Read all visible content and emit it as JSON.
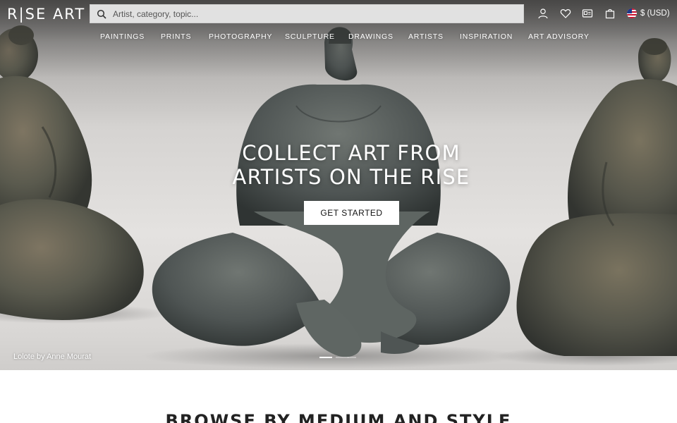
{
  "brand": {
    "logo_text": "R|SE ART"
  },
  "search": {
    "placeholder": "Artist, category, topic..."
  },
  "header_icons": [
    "user-icon",
    "heart-icon",
    "id-card-icon",
    "bag-icon"
  ],
  "currency": {
    "label": "$ (USD)",
    "flag": "us-flag-icon"
  },
  "nav": {
    "items": [
      {
        "label": "PAINTINGS"
      },
      {
        "label": "PRINTS"
      },
      {
        "label": "PHOTOGRAPHY"
      },
      {
        "label": "SCULPTURE"
      },
      {
        "label": "DRAWINGS"
      },
      {
        "label": "ARTISTS"
      },
      {
        "label": "INSPIRATION"
      },
      {
        "label": "ART ADVISORY"
      }
    ]
  },
  "hero": {
    "headline_line1": "COLLECT ART FROM",
    "headline_line2": "ARTISTS ON THE RISE",
    "cta_label": "GET STARTED",
    "caption": "Lolote by Anne Mourat",
    "slides_count": 3,
    "active_slide": 1
  },
  "sections": {
    "browse_title": "BROWSE BY MEDIUM AND STYLE"
  },
  "colors": {
    "white": "#ffffff",
    "search_bg": "#e1e1e1",
    "sculpture": "#4f5554",
    "text_dark": "#222222"
  }
}
